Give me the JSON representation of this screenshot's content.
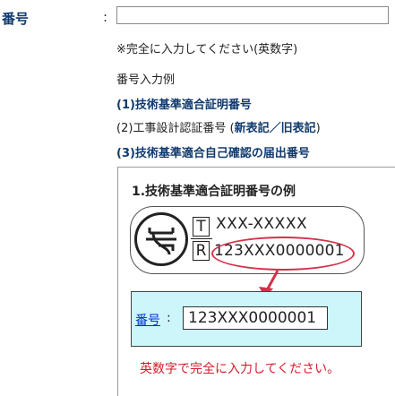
{
  "form": {
    "label": "番号",
    "colon": ":",
    "input_value": "",
    "note": "※完全に入力してください(英数字)"
  },
  "examples": {
    "title": "番号入力例",
    "option1": "(1)技術基準適合証明番号",
    "option2_prefix": "(2)工事設計認証番号 (",
    "option2_bold": "新表記／旧表記",
    "option2_suffix": ")",
    "option3": "(3)技術基準適合自己確認の届出番号"
  },
  "panel": {
    "title": "1.技術基準適合証明番号の例",
    "t_letter": "T",
    "r_letter": "R",
    "t_code": "XXX-XXXXX",
    "r_code": "123XXX0000001",
    "number_label": "番号",
    "number_colon": ":",
    "number_value": "123XXX0000001",
    "warning": "英数字で完全に入力してください。"
  },
  "colors": {
    "label_blue": "#103a6e",
    "highlight_red": "#d6314a",
    "warning_red": "#d21e2b",
    "cyan_bg": "#ccf6fa"
  }
}
